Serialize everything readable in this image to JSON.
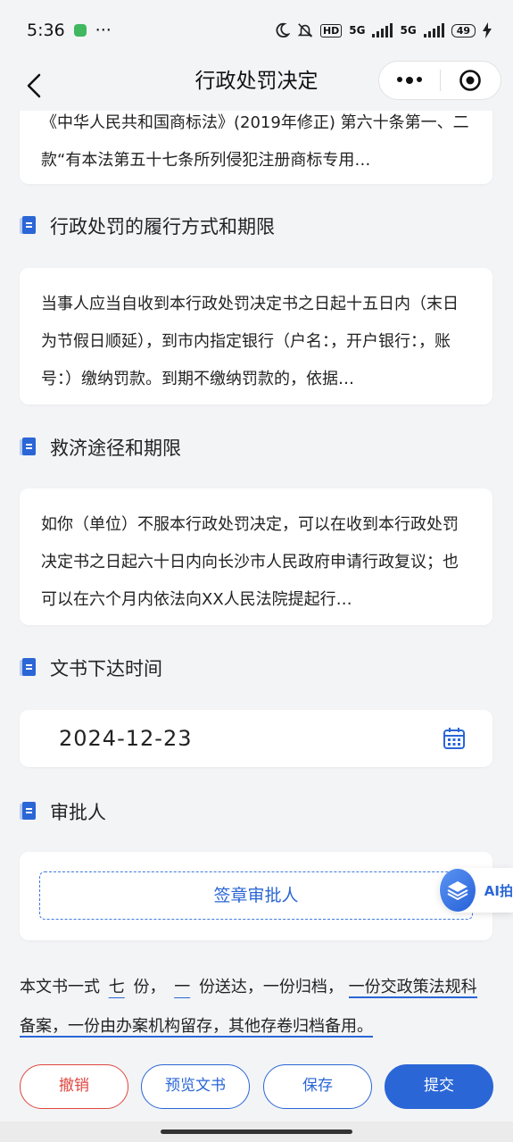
{
  "status_bar": {
    "time": "5:36",
    "more": "···",
    "hd": "HD",
    "net1": "5G",
    "net2": "5G",
    "battery": "49"
  },
  "nav": {
    "title": "行政处罚决定"
  },
  "sections": {
    "basis_text": "《中华人民共和国商标法》(2019年修正) 第六十条第一、二款“有本法第五十七条所列侵犯注册商标专用…",
    "performance": {
      "title": "行政处罚的履行方式和期限",
      "text": "当事人应当自收到本行政处罚决定书之日起十五日内（末日为节假日顺延），到市内指定银行（户名：，开户银行：，账号：）缴纳罚款。到期不缴纳罚款的，依据…"
    },
    "remedy": {
      "title": "救济途径和期限",
      "text": "如你（单位）不服本行政处罚决定，可以在收到本行政处罚决定书之日起六十日内向长沙市人民政府申请行政复议；也可以在六个月内依法向XX人民法院提起行…"
    },
    "issue_date": {
      "title": "文书下达时间",
      "value": "2024-12-23"
    },
    "approver": {
      "title": "审批人",
      "sign_label": "签章审批人"
    }
  },
  "ai_fab": {
    "label": "AI拍"
  },
  "footnote": {
    "part1": "本文书一式",
    "copies": "七",
    "part2": "份，",
    "served": "一",
    "part3": "份送达，一份归档，",
    "part4": "一份交政策法规科备案，一份由办案机构留存，其他存卷归档备用。"
  },
  "actions": {
    "cancel": "撤销",
    "preview": "预览文书",
    "save": "保存",
    "submit": "提交"
  },
  "colors": {
    "primary": "#2a66d6",
    "danger": "#e0463f",
    "background": "#f3f4f6"
  }
}
